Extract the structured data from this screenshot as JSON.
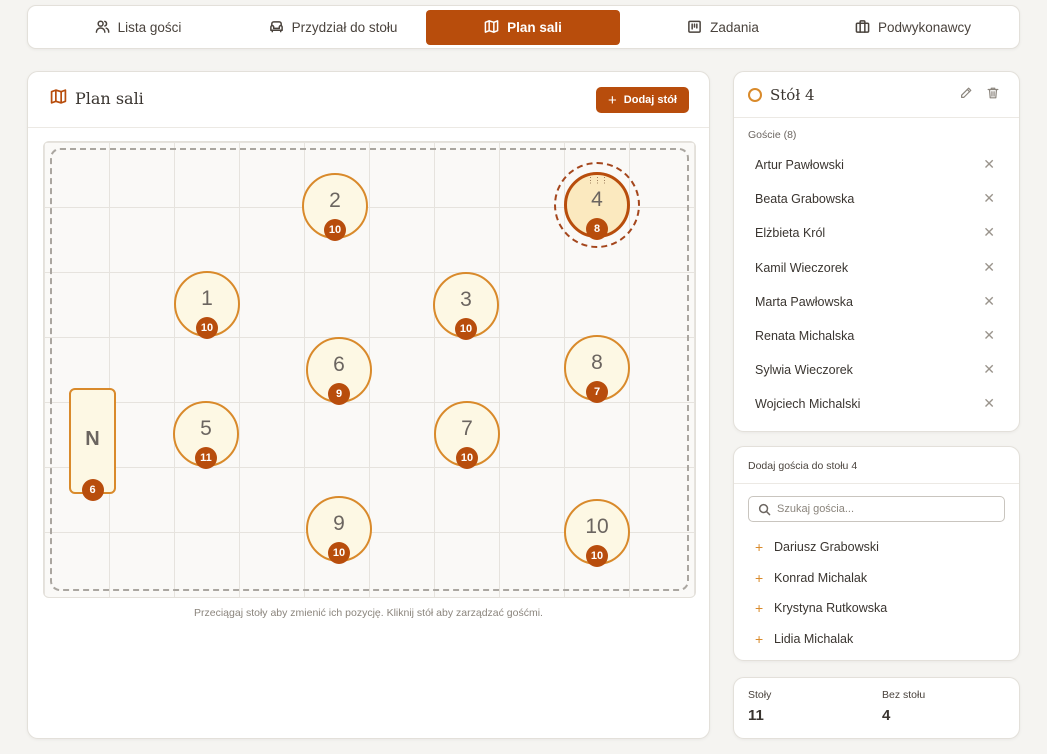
{
  "nav": {
    "tabs": [
      {
        "label": "Lista gości",
        "icon": "users-icon"
      },
      {
        "label": "Przydział do stołu",
        "icon": "armchair-icon"
      },
      {
        "label": "Plan sali",
        "icon": "map-icon"
      },
      {
        "label": "Zadania",
        "icon": "calendar-icon"
      },
      {
        "label": "Podwykonawcy",
        "icon": "briefcase-icon"
      }
    ],
    "active_tab": "Plan sali"
  },
  "plan": {
    "title": "Plan sali",
    "add_button": "Dodaj stół",
    "hint": "Przeciągaj stoły aby zmienić ich pozycję. Kliknij stół aby zarządzać gośćmi.",
    "head_table": {
      "label": "N",
      "guests": 6
    },
    "tables": [
      {
        "label": "1",
        "guests": 10
      },
      {
        "label": "2",
        "guests": 10
      },
      {
        "label": "3",
        "guests": 10
      },
      {
        "label": "4",
        "guests": 8,
        "selected": true
      },
      {
        "label": "5",
        "guests": 11
      },
      {
        "label": "6",
        "guests": 9
      },
      {
        "label": "7",
        "guests": 10
      },
      {
        "label": "8",
        "guests": 7
      },
      {
        "label": "9",
        "guests": 10
      },
      {
        "label": "10",
        "guests": 10
      }
    ]
  },
  "selected_table": {
    "title": "Stół 4",
    "guests_label": "Goście (8)",
    "guests": [
      "Artur Pawłowski",
      "Beata Grabowska",
      "Elżbieta Król",
      "Kamil Wieczorek",
      "Marta Pawłowska",
      "Renata Michalska",
      "Sylwia Wieczorek",
      "Wojciech Michalski"
    ]
  },
  "add_guest": {
    "title": "Dodaj gościa do stołu 4",
    "search_placeholder": "Szukaj gościa...",
    "candidates": [
      "Dariusz Grabowski",
      "Konrad Michalak",
      "Krystyna Rutkowska",
      "Lidia Michalak"
    ]
  },
  "stats": {
    "tables_label": "Stoły",
    "tables_value": "11",
    "unassigned_label": "Bez stołu",
    "unassigned_value": "4"
  },
  "colors": {
    "accent": "#b84d0c",
    "table_fill": "#fdf8e4",
    "table_border": "#d98a2b"
  }
}
